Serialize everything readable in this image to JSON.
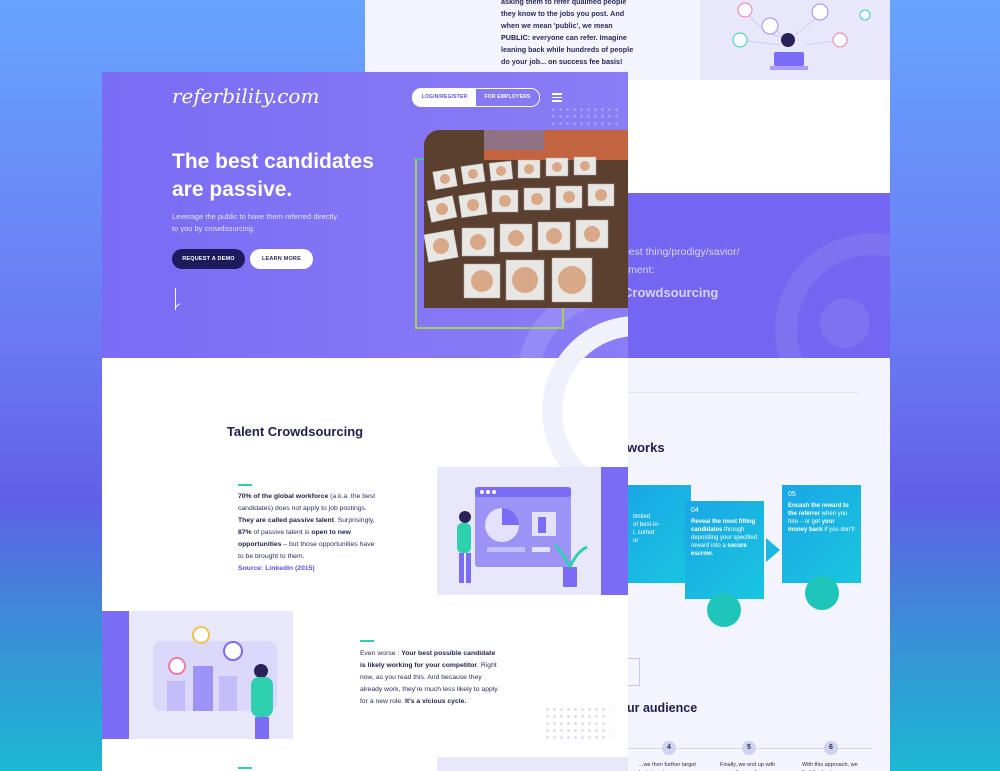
{
  "back": {
    "top_text": [
      {
        "text": "asking them to refer qualified people they know to the jobs you post. And when we mean 'public', we mean ",
        "bold": false
      },
      {
        "text": "PUBLIC:",
        "bold": true
      },
      {
        "text": " everyone can refer. Imagine leaning back while hundreds of people do your job... ",
        "bold": false
      },
      {
        "text": "on success fee basis!",
        "bold": true
      }
    ],
    "band_line1": "t best thing/prodigy/savior/",
    "band_line2": "uitment:",
    "band_title": "Crowdsourcing",
    "works_title": "works",
    "steps": [
      {
        "lines": "limited\nof best-in-\nl, sorted\nur"
      },
      {
        "num": "04",
        "bold": "Reveal the most fitting candidates",
        "rest": " through depositing your specified reward into a ",
        "bold2": "secure escrow."
      },
      {
        "num": "05",
        "bold": "Encash the reward to the referrer",
        "rest": " when you hire – or get ",
        "bold2": "your money back",
        "rest2": " if you don't!"
      }
    ],
    "audience_title": "ur audience",
    "nums": [
      "4",
      "5",
      "6"
    ],
    "num_texts": [
      "...we then further target by interests,",
      "Finally, we end up with an audience of a",
      "With this approach, we find the best"
    ]
  },
  "header": {
    "logo": "referbility.com",
    "login": "LOGIN/REGISTER",
    "employers": "FOR EMPLOYERS"
  },
  "hero": {
    "title_line1": "The best candidates",
    "title_line2": "are passive.",
    "subtitle": "Leverage the public to have them referred directly to you by crowdsourcing.",
    "primary_btn": "REQUEST A DEMO",
    "secondary_btn": "LEARN MORE"
  },
  "section": {
    "title": "Talent Crowdsourcing",
    "block1": {
      "p1_bold": "70% of the global workforce",
      "p1_rest": " (a.k.a. the best candidates) does not apply to job postings. ",
      "p1_bold2": "They are called passive talent",
      "p2": ". Surprisingly, ",
      "p2_bold": "87%",
      "p2_rest": " of passive talent is ",
      "p2_bold2": "open to new opportunities",
      "p2_rest2": " – but those opportunities have to be brought to them.",
      "source": "Source: LinkedIn (2015)"
    },
    "block2": {
      "a": "Even worse : ",
      "a_bold": "Your best possible candidate is likely working for your competitor",
      "b": ". Right now, as you read this. And because they already work, they're much less likely to apply for a new role. ",
      "b_bold": "It's a vicious cycle."
    }
  },
  "colors": {
    "primary": "#7a6cf4",
    "dark_navy": "#1e1a5e",
    "teal": "#1bb7e3",
    "accent_green": "#2fd0b0"
  }
}
